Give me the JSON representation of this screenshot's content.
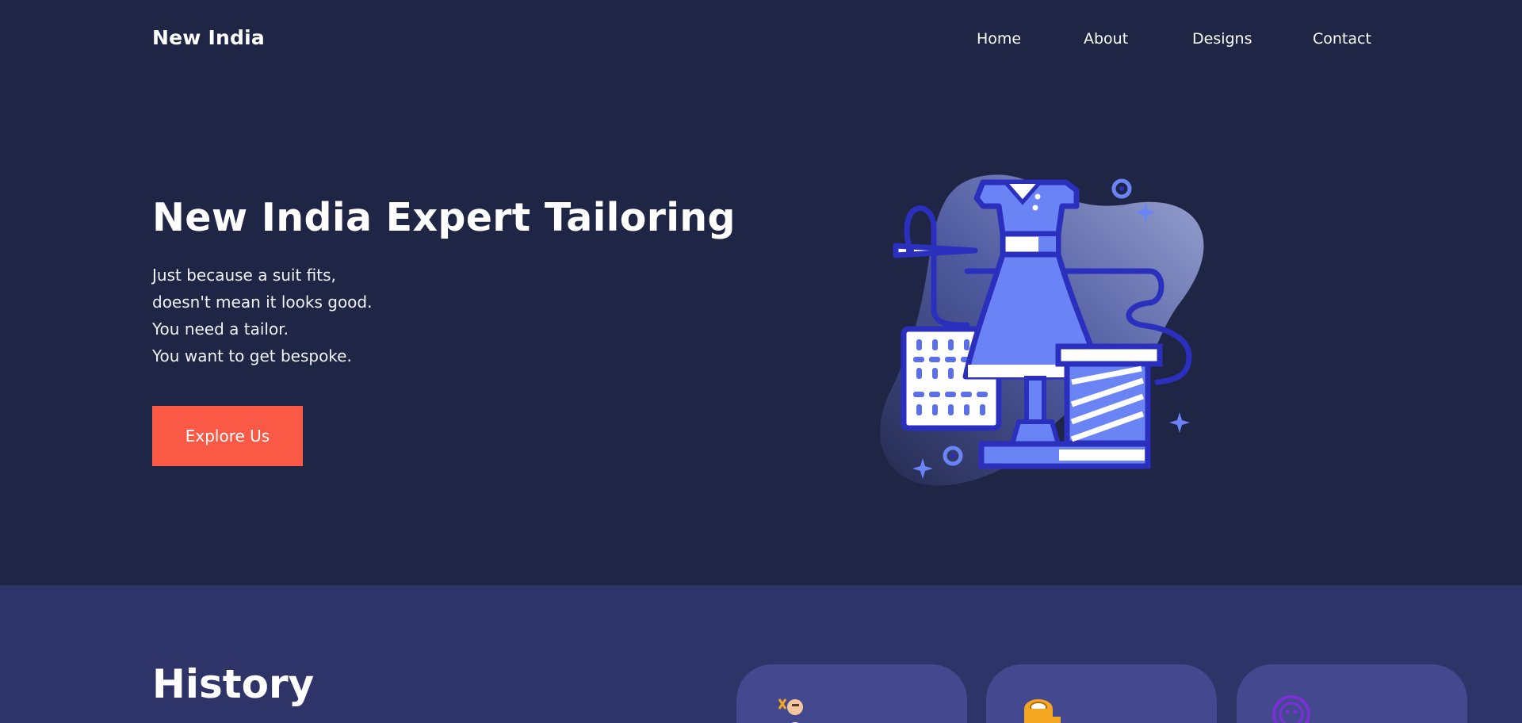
{
  "header": {
    "brand": "New India",
    "nav": [
      "Home",
      "About",
      "Designs",
      "Contact"
    ]
  },
  "hero": {
    "title": "New India Expert Tailoring",
    "lines": [
      "Just because a suit fits,",
      "doesn't mean it looks good.",
      "You need a tailor.",
      "You want to get bespoke."
    ],
    "cta_label": "Explore Us",
    "illustration_icon": "dress-mannequin-thread-spool-icon"
  },
  "history": {
    "title": "History",
    "cards": [
      {
        "icon": "tailor-person-icon"
      },
      {
        "icon": "measuring-tape-icon"
      },
      {
        "icon": "button-icon"
      }
    ]
  },
  "colors": {
    "background": "#1f2544",
    "section_bg": "#2f3468",
    "card_bg": "#43488f",
    "accent": "#fa5a45",
    "illustration_primary": "#2b2fbd",
    "illustration_fill": "#6b84f5"
  }
}
